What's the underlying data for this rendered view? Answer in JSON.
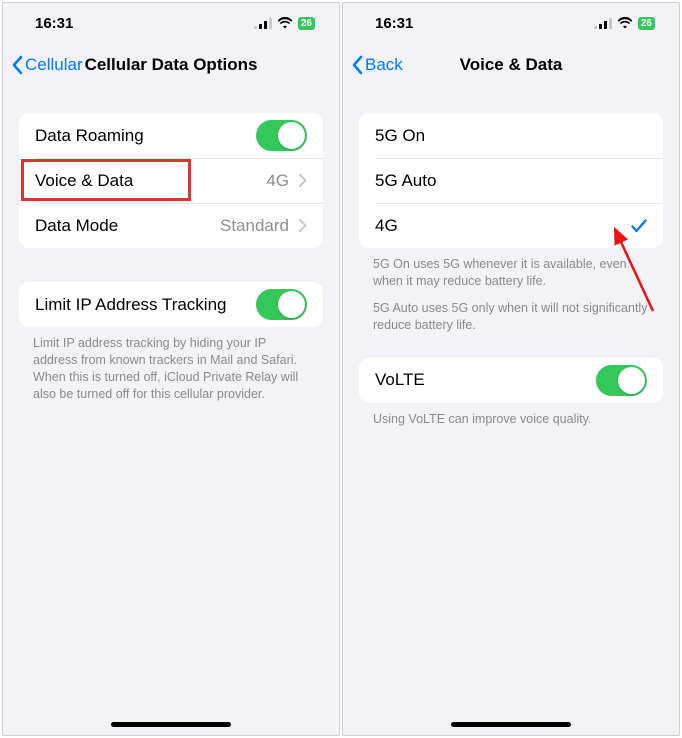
{
  "left": {
    "status": {
      "time": "16:31",
      "battery": "26"
    },
    "nav": {
      "back": "Cellular",
      "title": "Cellular Data Options"
    },
    "group1": {
      "data_roaming": "Data Roaming",
      "voice_data": {
        "label": "Voice & Data",
        "value": "4G"
      },
      "data_mode": {
        "label": "Data Mode",
        "value": "Standard"
      }
    },
    "group2": {
      "limit_ip": "Limit IP Address Tracking"
    },
    "footer": "Limit IP address tracking by hiding your IP address from known trackers in Mail and Safari. When this is turned off, iCloud Private Relay will also be turned off for this cellular provider."
  },
  "right": {
    "status": {
      "time": "16:31",
      "battery": "26"
    },
    "nav": {
      "back": "Back",
      "title": "Voice & Data"
    },
    "options": {
      "o1": "5G On",
      "o2": "5G Auto",
      "o3": "4G"
    },
    "footer1": "5G On uses 5G whenever it is available, even when it may reduce battery life.",
    "footer2": "5G Auto uses 5G only when it will not significantly reduce battery life.",
    "volte": {
      "label": "VoLTE"
    },
    "footer3": "Using VoLTE can improve voice quality."
  }
}
